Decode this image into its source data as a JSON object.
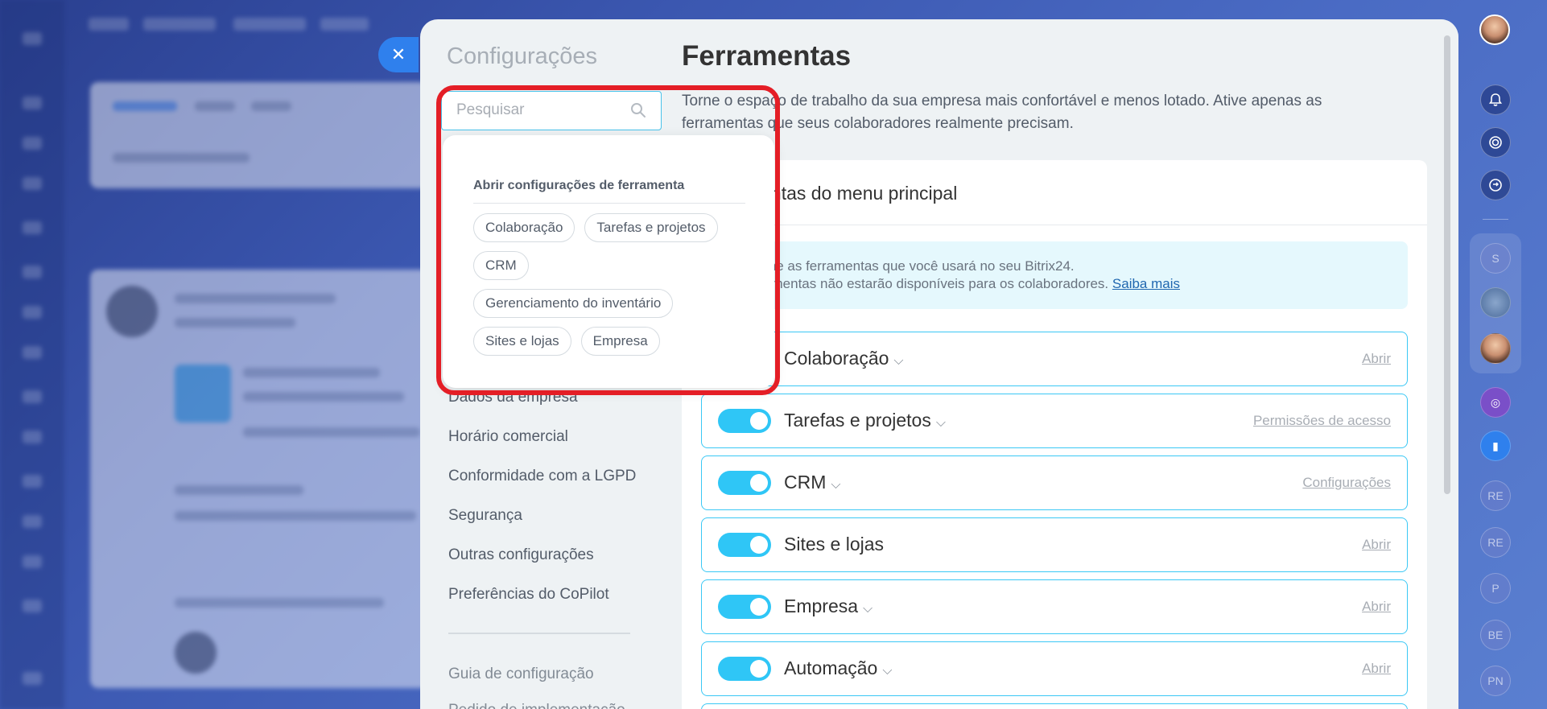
{
  "settings": {
    "title": "Configurações",
    "menu": [
      {
        "label": "Dados da empresa"
      },
      {
        "label": "Horário comercial"
      },
      {
        "label": "Conformidade com a LGPD"
      },
      {
        "label": "Segurança"
      },
      {
        "label": "Outras configurações"
      },
      {
        "label": "Preferências do CoPilot"
      }
    ],
    "footer_menu": [
      {
        "label": "Guia de configuração"
      },
      {
        "label": "Pedido de implementação"
      }
    ]
  },
  "search": {
    "placeholder": "Pesquisar",
    "value": ""
  },
  "dropdown": {
    "title": "Abrir configurações de ferramenta",
    "chips": [
      {
        "label": "Colaboração"
      },
      {
        "label": "Tarefas e projetos"
      },
      {
        "label": "CRM"
      },
      {
        "label": "Gerenciamento do inventário"
      },
      {
        "label": "Sites e lojas"
      },
      {
        "label": "Empresa"
      }
    ]
  },
  "page": {
    "title": "Ferramentas",
    "intro": "Torne o espaço de trabalho da sua empresa mais confortável e menos lotado. Ative apenas as ferramentas que seus colaboradores realmente precisam."
  },
  "card": {
    "title": "Ferramentas do menu principal",
    "info_line1": "Selecione as ferramentas que você usará no seu Bitrix24.",
    "info_line2": "As ferramentas não estarão disponíveis para os colaboradores.",
    "info_link": "Saiba mais",
    "tools": [
      {
        "label": "Colaboração",
        "action": "Abrir",
        "enabled": true
      },
      {
        "label": "Tarefas e projetos",
        "action": "Permissões de acesso",
        "enabled": true
      },
      {
        "label": "CRM",
        "action": "Configurações",
        "enabled": true
      },
      {
        "label": "Sites e lojas",
        "action": "Abrir",
        "enabled": true
      },
      {
        "label": "Empresa",
        "action": "Abrir",
        "enabled": true
      },
      {
        "label": "Automação",
        "action": "Abrir",
        "enabled": true
      }
    ]
  },
  "rail": {
    "chats": [
      {
        "label": "S"
      },
      {
        "label": "RE"
      },
      {
        "label": "RE"
      },
      {
        "label": "P"
      },
      {
        "label": "BE"
      },
      {
        "label": "PN"
      }
    ]
  },
  "colors": {
    "accent": "#2fc6f6",
    "close_button": "#2f80ed",
    "highlight_frame": "#e41e26",
    "link": "#2067b0"
  }
}
